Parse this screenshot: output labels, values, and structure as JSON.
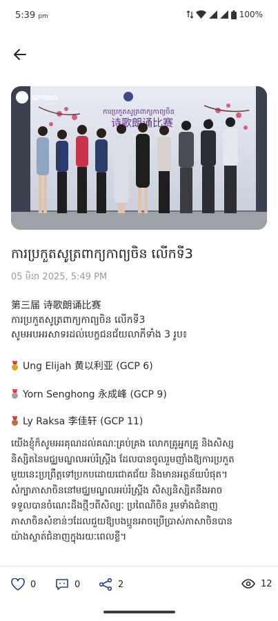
{
  "status": {
    "time": "5:39",
    "ampm": "pm",
    "battery": "100%"
  },
  "post": {
    "title": "ការប្រកួតសូត្រពាក្យកាព្យចិន លើកទី3",
    "date": "05 មិនា 2025, 5:49 PM",
    "line1": "第三届 诗歌朗诵比赛",
    "line2": "ការប្រកួតសូត្រពាក្យកាព្យចិន លើកទី3",
    "line3": "សូមអបអរសាទរដល់បេក្ខជនជ័យលាភីទាំង 3 រូប៖",
    "prizes": [
      {
        "text": "Ung Elijah 黄以利亚 (GCP 6)",
        "medal_color": "#e0a11b"
      },
      {
        "text": "Yorn Senghong 永成峰 (GCP 9)",
        "medal_color": "#9aa3ad"
      },
      {
        "text": "Ly Raksa 李佳轩 (GCP 11)",
        "medal_color": "#c0703a"
      }
    ],
    "paragraph": [
      "យើងខ្ញុំក៏សូមអរគុណដល់គណៈគ្រប់គ្រង លោកគ្រូអ្នកគ្រូ និងសិស្ស",
      "និស្សិតនៃមជ្ឈមណ្ឌលអប់រំស្ព្រីង ដែលបានចូលរួមញាំងឱ្យការប្រកួត",
      "មួយនេះប្រព្រឹត្តទៅប្រកបដោយជោគជ័យ និងមានអត្ថន័យបំផុត។",
      "សំក្បាភាសាចិននៅមជ្ឈមណ្ឌលអប់រំស្ព្រីង សិស្សនិស្សិតនឹងអាច",
      "ទទួលបានចំណេះដឹងថ្មីៗពីសិល្បៈ ប្រពៃណីចិន រួមទាំងជំនាញ",
      "ភាសាចិនសំខាន់ៗដែលជួយឱ្យបងប្អូនអាចប្រើប្រាស់ភាសាចិនបាន",
      "យ៉ាងស្ទាត់ជំនាញក្នុងរយៈពេលខ្លី។"
    ]
  },
  "hero": {
    "logo": "SPRING",
    "banner_khmer": "ការប្រកួតសូត្រពាក្យកាព្យចិន",
    "banner_chinese": "诗歌朗诵比赛"
  },
  "actions": {
    "likes": "0",
    "comments": "0",
    "shares": "2",
    "views": "12"
  },
  "icons": {
    "back": "arrow-left-icon",
    "like": "heart-icon",
    "comment": "comment-icon",
    "share": "share-icon",
    "view": "eye-icon"
  },
  "colors": {
    "accent": "#1f3f8f",
    "muted": "#9a9a9a"
  }
}
